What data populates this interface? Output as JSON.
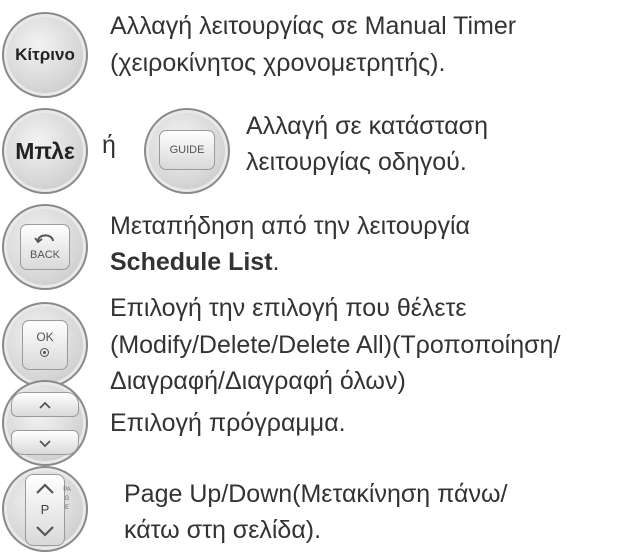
{
  "rows": [
    {
      "button": "Κίτρινο",
      "text": [
        "Αλλαγή λειτουργίας σε Manual Timer",
        "(χειροκίνητος χρονομετρητής)."
      ]
    },
    {
      "button": "Μπλε",
      "or": "ή",
      "guide": "GUIDE",
      "text": [
        "Αλλαγή σε κατάσταση",
        "λειτουργίας οδηγού."
      ]
    },
    {
      "button": "BACK",
      "text_plain": "Μεταπήδηση από την λειτουργία",
      "text_bold": "Schedule List",
      "text_tail": "."
    },
    {
      "button": "OK",
      "text": [
        "Επιλογή την επιλογή που θέλετε",
        "(Modify/Delete/Delete All)(Τροποποίηση/",
        "Διαγραφή/Διαγραφή όλων)"
      ]
    },
    {
      "text": [
        "Επιλογή πρόγραμμα."
      ]
    },
    {
      "button": "P",
      "side": "PAGE",
      "text": [
        "Page Up/Down(Μετακίνηση πάνω/",
        "κάτω στη σελίδα)."
      ]
    }
  ]
}
